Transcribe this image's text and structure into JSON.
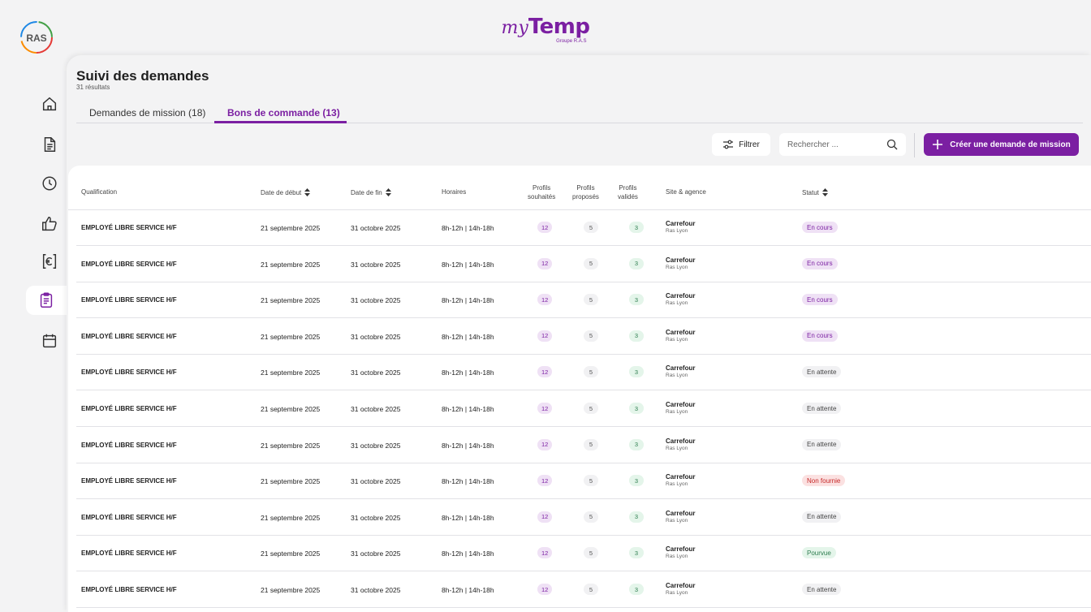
{
  "brand": {
    "my": "my",
    "temp": "Temp",
    "sub": "Groupe R.A.S",
    "logo_text": "RAS"
  },
  "sidebar": {
    "items": [
      {
        "name": "home-icon"
      },
      {
        "name": "document-icon"
      },
      {
        "name": "clock-icon"
      },
      {
        "name": "thumbs-up-icon"
      },
      {
        "name": "euro-icon"
      },
      {
        "name": "clipboard-icon",
        "active": true
      },
      {
        "name": "calendar-icon"
      }
    ]
  },
  "page": {
    "title": "Suivi des demandes",
    "subtitle": "31 résultats"
  },
  "tabs": [
    {
      "label": "Demandes de mission (18)",
      "active": false
    },
    {
      "label": "Bons de commande (13)",
      "active": true
    }
  ],
  "toolbar": {
    "filter_label": "Filtrer",
    "search_placeholder": "Rechercher ...",
    "create_label": "Créer une demande de mission"
  },
  "table": {
    "headers": {
      "qualification": "Qualification",
      "date_debut": "Date de début",
      "date_fin": "Date de fin",
      "horaires": "Horaires",
      "souhaites_1": "Profils",
      "souhaites_2": "souhaités",
      "proposes_1": "Profils",
      "proposes_2": "proposés",
      "valides_1": "Profils",
      "valides_2": "validés",
      "site": "Site & agence",
      "statut": "Statut"
    },
    "rows": [
      {
        "qual": "EMPLOYÉ LIBRE SERVICE H/F",
        "debut": "21 septembre 2025",
        "fin": "31 octobre 2025",
        "horaires": "8h-12h | 14h-18h",
        "souhaites": "12",
        "proposes": "5",
        "valides": "3",
        "site": "Carrefour",
        "agence": "Ras Lyon",
        "statut": "En cours"
      },
      {
        "qual": "EMPLOYÉ LIBRE SERVICE H/F",
        "debut": "21 septembre 2025",
        "fin": "31 octobre 2025",
        "horaires": "8h-12h | 14h-18h",
        "souhaites": "12",
        "proposes": "5",
        "valides": "3",
        "site": "Carrefour",
        "agence": "Ras Lyon",
        "statut": "En cours"
      },
      {
        "qual": "EMPLOYÉ LIBRE SERVICE H/F",
        "debut": "21 septembre 2025",
        "fin": "31 octobre 2025",
        "horaires": "8h-12h | 14h-18h",
        "souhaites": "12",
        "proposes": "5",
        "valides": "3",
        "site": "Carrefour",
        "agence": "Ras Lyon",
        "statut": "En cours"
      },
      {
        "qual": "EMPLOYÉ LIBRE SERVICE H/F",
        "debut": "21 septembre 2025",
        "fin": "31 octobre 2025",
        "horaires": "8h-12h | 14h-18h",
        "souhaites": "12",
        "proposes": "5",
        "valides": "3",
        "site": "Carrefour",
        "agence": "Ras Lyon",
        "statut": "En cours"
      },
      {
        "qual": "EMPLOYÉ LIBRE SERVICE H/F",
        "debut": "21 septembre 2025",
        "fin": "31 octobre 2025",
        "horaires": "8h-12h | 14h-18h",
        "souhaites": "12",
        "proposes": "5",
        "valides": "3",
        "site": "Carrefour",
        "agence": "Ras Lyon",
        "statut": "En attente"
      },
      {
        "qual": "EMPLOYÉ LIBRE SERVICE H/F",
        "debut": "21 septembre 2025",
        "fin": "31 octobre 2025",
        "horaires": "8h-12h | 14h-18h",
        "souhaites": "12",
        "proposes": "5",
        "valides": "3",
        "site": "Carrefour",
        "agence": "Ras Lyon",
        "statut": "En attente"
      },
      {
        "qual": "EMPLOYÉ LIBRE SERVICE H/F",
        "debut": "21 septembre 2025",
        "fin": "31 octobre 2025",
        "horaires": "8h-12h | 14h-18h",
        "souhaites": "12",
        "proposes": "5",
        "valides": "3",
        "site": "Carrefour",
        "agence": "Ras Lyon",
        "statut": "En attente"
      },
      {
        "qual": "EMPLOYÉ LIBRE SERVICE H/F",
        "debut": "21 septembre 2025",
        "fin": "31 octobre 2025",
        "horaires": "8h-12h | 14h-18h",
        "souhaites": "12",
        "proposes": "5",
        "valides": "3",
        "site": "Carrefour",
        "agence": "Ras Lyon",
        "statut": "Non fournie"
      },
      {
        "qual": "EMPLOYÉ LIBRE SERVICE H/F",
        "debut": "21 septembre 2025",
        "fin": "31 octobre 2025",
        "horaires": "8h-12h | 14h-18h",
        "souhaites": "12",
        "proposes": "5",
        "valides": "3",
        "site": "Carrefour",
        "agence": "Ras Lyon",
        "statut": "En attente"
      },
      {
        "qual": "EMPLOYÉ LIBRE SERVICE H/F",
        "debut": "21 septembre 2025",
        "fin": "31 octobre 2025",
        "horaires": "8h-12h | 14h-18h",
        "souhaites": "12",
        "proposes": "5",
        "valides": "3",
        "site": "Carrefour",
        "agence": "Ras Lyon",
        "statut": "Pourvue"
      },
      {
        "qual": "EMPLOYÉ LIBRE SERVICE H/F",
        "debut": "21 septembre 2025",
        "fin": "31 octobre 2025",
        "horaires": "8h-12h | 14h-18h",
        "souhaites": "12",
        "proposes": "5",
        "valides": "3",
        "site": "Carrefour",
        "agence": "Ras Lyon",
        "statut": "En attente"
      }
    ]
  },
  "colors": {
    "accent": "#7b1fa2",
    "background": "#f3f3f4"
  }
}
